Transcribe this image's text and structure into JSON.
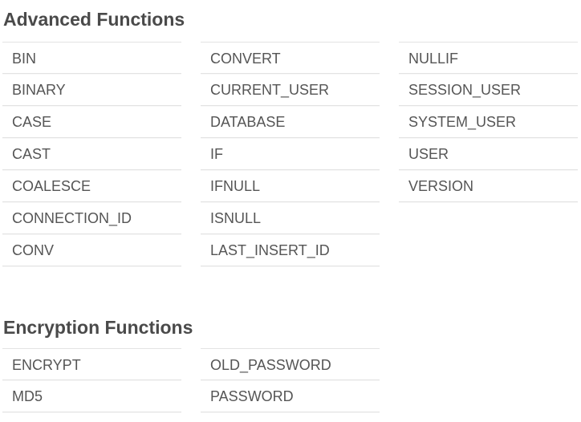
{
  "advanced": {
    "title": "Advanced Functions",
    "columns": [
      [
        "BIN",
        "BINARY",
        "CASE",
        "CAST",
        "COALESCE",
        "CONNECTION_ID",
        "CONV"
      ],
      [
        "CONVERT",
        "CURRENT_USER",
        "DATABASE",
        "IF",
        "IFNULL",
        "ISNULL",
        "LAST_INSERT_ID"
      ],
      [
        "NULLIF",
        "SESSION_USER",
        "SYSTEM_USER",
        "USER",
        "VERSION"
      ]
    ]
  },
  "encryption": {
    "title": "Encryption Functions",
    "columns": [
      [
        "ENCRYPT",
        "MD5"
      ],
      [
        "OLD_PASSWORD",
        "PASSWORD"
      ]
    ]
  }
}
